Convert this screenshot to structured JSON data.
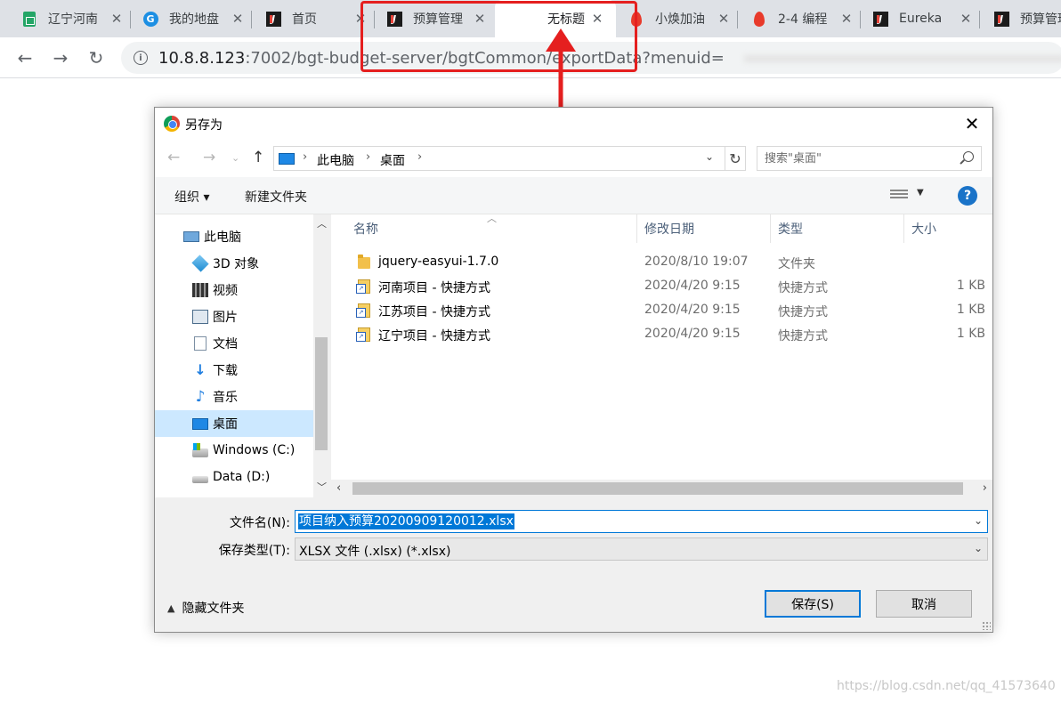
{
  "browser": {
    "tabs": [
      {
        "title": "辽宁河南",
        "icon": "sheets-icon"
      },
      {
        "title": "我的地盘",
        "icon": "circle-logo-icon"
      },
      {
        "title": "首页",
        "icon": "jetbrains-icon"
      },
      {
        "title": "预算管理",
        "icon": "jetbrains-icon"
      },
      {
        "title": "无标题",
        "icon": "none"
      },
      {
        "title": "小焕加油",
        "icon": "flame-icon"
      },
      {
        "title": "2-4 编程",
        "icon": "flame-icon"
      },
      {
        "title": "Eureka",
        "icon": "jetbrains-icon"
      },
      {
        "title": "预算管理",
        "icon": "jetbrains-icon"
      }
    ],
    "active_tab_index": 4,
    "url_host": "10.8.8.123",
    "url_path": ":7002/bgt-budget-server/bgtCommon/exportData?menuid="
  },
  "dialog": {
    "title": "另存为",
    "breadcrumb": [
      "此电脑",
      "桌面"
    ],
    "search_placeholder": "搜索\"桌面\"",
    "toolbar": {
      "organize": "组织 ▾",
      "new_folder": "新建文件夹"
    },
    "nav_items": [
      {
        "label": "此电脑",
        "icon": "computer-icon"
      },
      {
        "label": "3D 对象",
        "icon": "3d-objects-icon"
      },
      {
        "label": "视频",
        "icon": "video-icon"
      },
      {
        "label": "图片",
        "icon": "pictures-icon"
      },
      {
        "label": "文档",
        "icon": "documents-icon"
      },
      {
        "label": "下载",
        "icon": "downloads-icon"
      },
      {
        "label": "音乐",
        "icon": "music-icon"
      },
      {
        "label": "桌面",
        "icon": "desktop-icon"
      },
      {
        "label": "Windows (C:)",
        "icon": "windows-drive-icon"
      },
      {
        "label": "Data (D:)",
        "icon": "drive-icon"
      }
    ],
    "selected_nav_index": 7,
    "columns": {
      "name": "名称",
      "date": "修改日期",
      "type": "类型",
      "size": "大小"
    },
    "files": [
      {
        "name": "jquery-easyui-1.7.0",
        "date": "2020/8/10 19:07",
        "type": "文件夹",
        "size": "",
        "icon": "folder-icon"
      },
      {
        "name": "河南项目 - 快捷方式",
        "date": "2020/4/20 9:15",
        "type": "快捷方式",
        "size": "1 KB",
        "icon": "shortcut-icon"
      },
      {
        "name": "江苏项目 - 快捷方式",
        "date": "2020/4/20 9:15",
        "type": "快捷方式",
        "size": "1 KB",
        "icon": "shortcut-icon"
      },
      {
        "name": "辽宁项目 - 快捷方式",
        "date": "2020/4/20 9:15",
        "type": "快捷方式",
        "size": "1 KB",
        "icon": "shortcut-icon"
      }
    ],
    "filename_label": "文件名(N):",
    "filename_value": "项目纳入预算20200909120012.xlsx",
    "savetype_label": "保存类型(T):",
    "savetype_value": "XLSX 文件 (.xlsx) (*.xlsx)",
    "hide_folders": "隐藏文件夹",
    "save_button": "保存(S)",
    "cancel_button": "取消"
  },
  "watermark": "https://blog.csdn.net/qq_41573640",
  "colors": {
    "annotation": "#e51f1f",
    "selection": "#0078d7",
    "nav_selected": "#cce8ff"
  }
}
